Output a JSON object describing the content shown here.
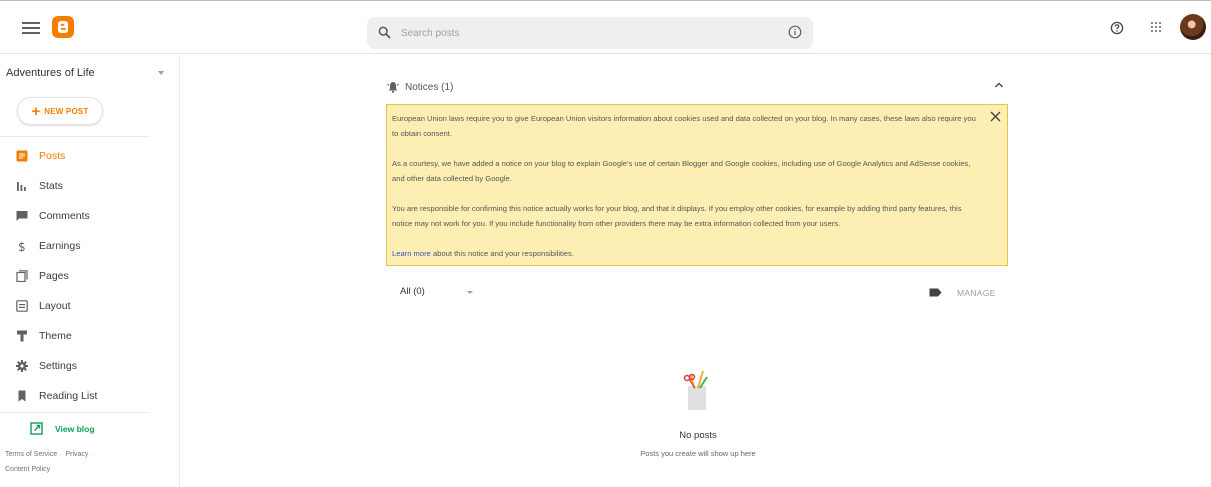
{
  "search": {
    "placeholder": "Search posts"
  },
  "sidebar": {
    "blog_title": "Adventures of Life",
    "new_post_label": "NEW POST",
    "items": [
      {
        "label": "Posts",
        "icon": "posts-icon",
        "active": true
      },
      {
        "label": "Stats",
        "icon": "stats-icon"
      },
      {
        "label": "Comments",
        "icon": "comments-icon"
      },
      {
        "label": "Earnings",
        "icon": "dollar-icon"
      },
      {
        "label": "Pages",
        "icon": "pages-icon"
      },
      {
        "label": "Layout",
        "icon": "layout-icon"
      },
      {
        "label": "Theme",
        "icon": "theme-icon"
      },
      {
        "label": "Settings",
        "icon": "gear-icon"
      },
      {
        "label": "Reading List",
        "icon": "bookmark-icon"
      }
    ],
    "view_blog_label": "View blog",
    "footer": {
      "terms": "Terms of Service",
      "privacy": "Privacy",
      "content_policy": "Content Policy"
    }
  },
  "notices": {
    "title": "Notices (1)",
    "paragraphs": [
      "European Union laws require you to give European Union visitors information about cookies used and data collected on your blog. In many cases, these laws also require you to obtain consent.",
      "As a courtesy, we have added a notice on your blog to explain Google's use of certain Blogger and Google cookies, including use of Google Analytics and AdSense cookies, and other data collected by Google.",
      "You are responsible for confirming this notice actually works for your blog, and that it displays. If you employ other cookies, for example by adding third party features, this notice may not work for you. If you include functionality from other providers there may be extra information collected from your users."
    ],
    "learn_more": "Learn more",
    "learn_more_suffix": " about this notice and your responsibilities."
  },
  "filter": {
    "label": "All (0)"
  },
  "manage_label": "MANAGE",
  "empty": {
    "title": "No posts",
    "subtitle": "Posts you create will show up here"
  },
  "colors": {
    "brand": "#f57d00",
    "notice_bg": "#fdefb4",
    "notice_border": "#e7c446",
    "view_blog": "#0f9d58",
    "link": "#3f51b5"
  }
}
